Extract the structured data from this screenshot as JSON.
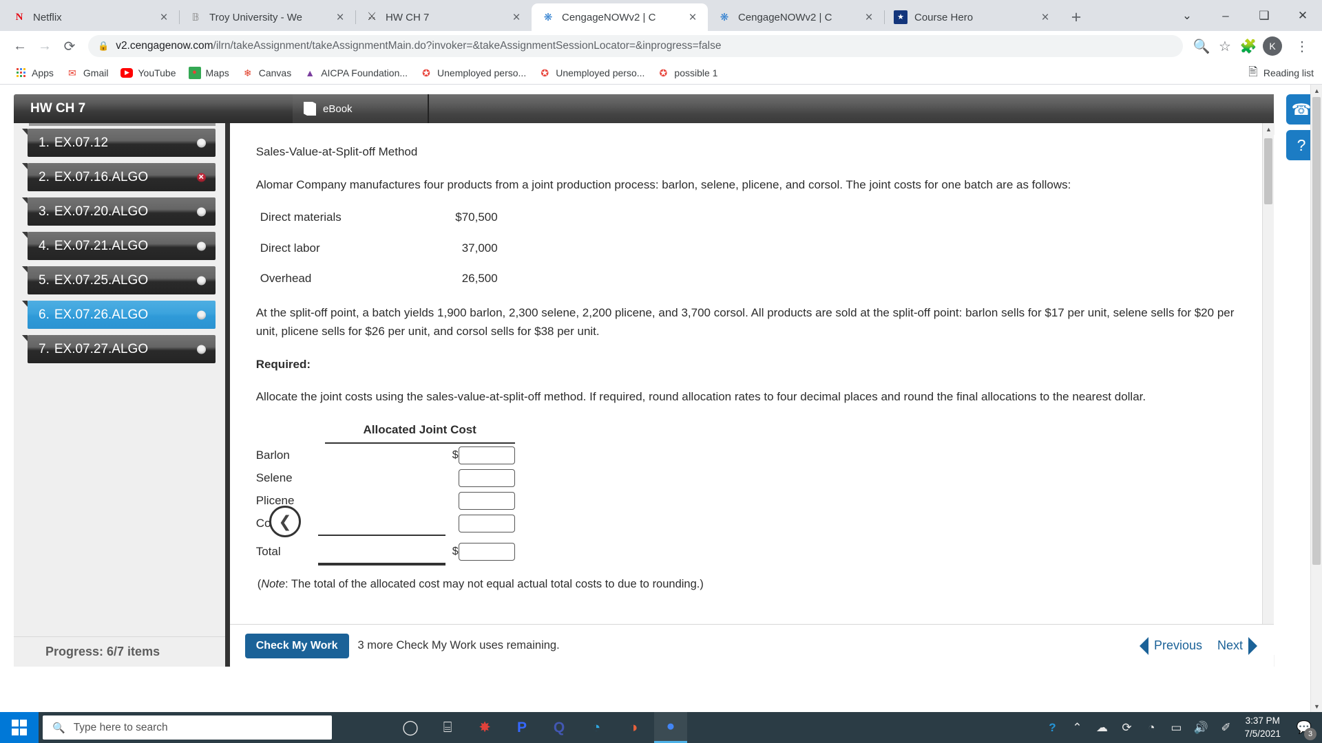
{
  "browser": {
    "tabs": [
      {
        "title": "Netflix",
        "icon": "netflix-icon",
        "active": false
      },
      {
        "title": "Troy University - We",
        "icon": "troy-university-icon",
        "active": false
      },
      {
        "title": "HW CH 7",
        "icon": "trojan-icon",
        "active": false
      },
      {
        "title": "CengageNOWv2 | C",
        "icon": "cengage-icon",
        "active": true
      },
      {
        "title": "CengageNOWv2 | C",
        "icon": "cengage-icon",
        "active": false
      },
      {
        "title": "Course Hero",
        "icon": "course-hero-icon",
        "active": false
      }
    ],
    "new_tab_label": "+",
    "close_label": "×",
    "window_controls": {
      "minimize": "–",
      "maximize": "❑",
      "close": "✕",
      "extra": "⌄"
    },
    "profile_initial": "K",
    "nav": {
      "back": "←",
      "forward": "→",
      "reload": "⟳"
    },
    "address": {
      "lock_icon": "lock-icon",
      "host": "v2.cengagenow.com",
      "path": "/ilrn/takeAssignment/takeAssignmentMain.do?invoker=&takeAssignmentSessionLocator=&inprogress=false",
      "zoom_icon": "zoom-magnifier-icon",
      "star_icon": "bookmark-star-icon",
      "extensions_icon": "extensions-puzzle-icon",
      "menu_icon": "three-dot-menu-icon"
    },
    "bookmarks": [
      {
        "label": "Apps",
        "icon": "apps-grid-icon"
      },
      {
        "label": "Gmail",
        "icon": "gmail-icon"
      },
      {
        "label": "YouTube",
        "icon": "youtube-icon"
      },
      {
        "label": "Maps",
        "icon": "maps-icon"
      },
      {
        "label": "Canvas",
        "icon": "canvas-icon"
      },
      {
        "label": "AICPA Foundation...",
        "icon": "aicpa-icon"
      },
      {
        "label": "Unemployed perso...",
        "icon": "star-red-icon"
      },
      {
        "label": "Unemployed perso...",
        "icon": "star-red-icon"
      },
      {
        "label": "possible 1",
        "icon": "star-red-icon"
      }
    ],
    "reading_list": {
      "label": "Reading list",
      "icon": "reading-list-icon"
    }
  },
  "app": {
    "assignment_title": "HW CH 7",
    "ebook_tab": "eBook",
    "sidebar_items": [
      {
        "num": "1.",
        "label": "EX.07.12",
        "status": "dot",
        "selected": false
      },
      {
        "num": "2.",
        "label": "EX.07.16.ALGO",
        "status": "error",
        "selected": false
      },
      {
        "num": "3.",
        "label": "EX.07.20.ALGO",
        "status": "dot",
        "selected": false
      },
      {
        "num": "4.",
        "label": "EX.07.21.ALGO",
        "status": "dot",
        "selected": false
      },
      {
        "num": "5.",
        "label": "EX.07.25.ALGO",
        "status": "dot",
        "selected": false
      },
      {
        "num": "6.",
        "label": "EX.07.26.ALGO",
        "status": "dot",
        "selected": true
      },
      {
        "num": "7.",
        "label": "EX.07.27.ALGO",
        "status": "dot",
        "selected": false
      }
    ],
    "error_mark": "✕",
    "progress": "Progress:  6/7 items",
    "collapse_icon": "chevron-left-icon",
    "fabs": [
      {
        "icon": "headset-support-icon",
        "glyph": "☎"
      },
      {
        "icon": "help-question-icon",
        "glyph": "?"
      }
    ]
  },
  "question": {
    "heading": "Sales-Value-at-Split-off Method",
    "intro": "Alomar Company manufactures four products from a joint production process: barlon, selene, plicene, and corsol. The joint costs for one batch are as follows:",
    "costs": [
      {
        "label": "Direct materials",
        "value": "$70,500"
      },
      {
        "label": "Direct labor",
        "value": "37,000"
      },
      {
        "label": "Overhead",
        "value": "26,500"
      }
    ],
    "split_off_text": "At the split-off point, a batch yields 1,900 barlon, 2,300 selene, 2,200 plicene, and 3,700 corsol. All products are sold at the split-off point: barlon sells for $17 per unit, selene sells for $20 per unit, plicene sells for $26 per unit, and corsol sells for $38 per unit.",
    "required_label": "Required:",
    "required_text": "Allocate the joint costs using the sales-value-at-split-off method. If required, round allocation rates to four decimal places and round the final allocations to the nearest dollar.",
    "table_header": "Allocated Joint Cost",
    "rows": [
      {
        "name": "Barlon",
        "prefix": "$",
        "value": ""
      },
      {
        "name": "Selene",
        "prefix": "",
        "value": ""
      },
      {
        "name": "Plicene",
        "prefix": "",
        "value": ""
      },
      {
        "name": "Corsol",
        "prefix": "",
        "value": ""
      },
      {
        "name": "Total",
        "prefix": "$",
        "value": ""
      }
    ],
    "note_italic": "Note",
    "note_text": ": The total of the allocated cost may not equal actual total costs to due to rounding.)",
    "note_open": "("
  },
  "footer": {
    "check_button": "Check My Work",
    "check_note": "3 more Check My Work uses remaining.",
    "previous": "Previous",
    "next": "Next"
  },
  "taskbar": {
    "search_placeholder": "Type here to search",
    "search_icon": "search-icon",
    "start_icon": "windows-start-icon",
    "apps": [
      {
        "icon": "cortana-circle-icon",
        "glyph": "◯",
        "active": false
      },
      {
        "icon": "task-view-icon",
        "glyph": "⌸",
        "active": false
      },
      {
        "icon": "red-app-icon",
        "glyph": "✸",
        "active": false
      },
      {
        "icon": "pandora-p-icon",
        "glyph": "P",
        "active": false
      },
      {
        "icon": "quizlet-q-icon",
        "glyph": "Q",
        "active": false
      },
      {
        "icon": "edge-browser-icon",
        "glyph": "◔",
        "active": false
      },
      {
        "icon": "office-app-icon",
        "glyph": "◑",
        "active": false
      },
      {
        "icon": "chrome-browser-icon",
        "glyph": "●",
        "active": true
      }
    ],
    "tray": [
      {
        "icon": "help-get-started-icon",
        "glyph": "?"
      },
      {
        "icon": "show-hidden-icons-chevron",
        "glyph": "⌃"
      },
      {
        "icon": "onedrive-cloud-icon",
        "glyph": "☁"
      },
      {
        "icon": "sync-update-icon",
        "glyph": "⟳"
      },
      {
        "icon": "wifi-icon",
        "glyph": "◔"
      },
      {
        "icon": "battery-charging-icon",
        "glyph": "▭"
      },
      {
        "icon": "volume-speaker-icon",
        "glyph": "🔊"
      },
      {
        "icon": "pen-bluetooth-icon",
        "glyph": "✐"
      }
    ],
    "time": "3:37 PM",
    "date": "7/5/2021",
    "notification_icon": "notification-center-icon",
    "notification_count": "3"
  },
  "colors": {
    "accent_blue": "#1b6298",
    "selected_item": "#2f9ad8",
    "error_red": "#c4283a",
    "taskbar": "#2b3c45",
    "start_blue": "#0078d7"
  }
}
